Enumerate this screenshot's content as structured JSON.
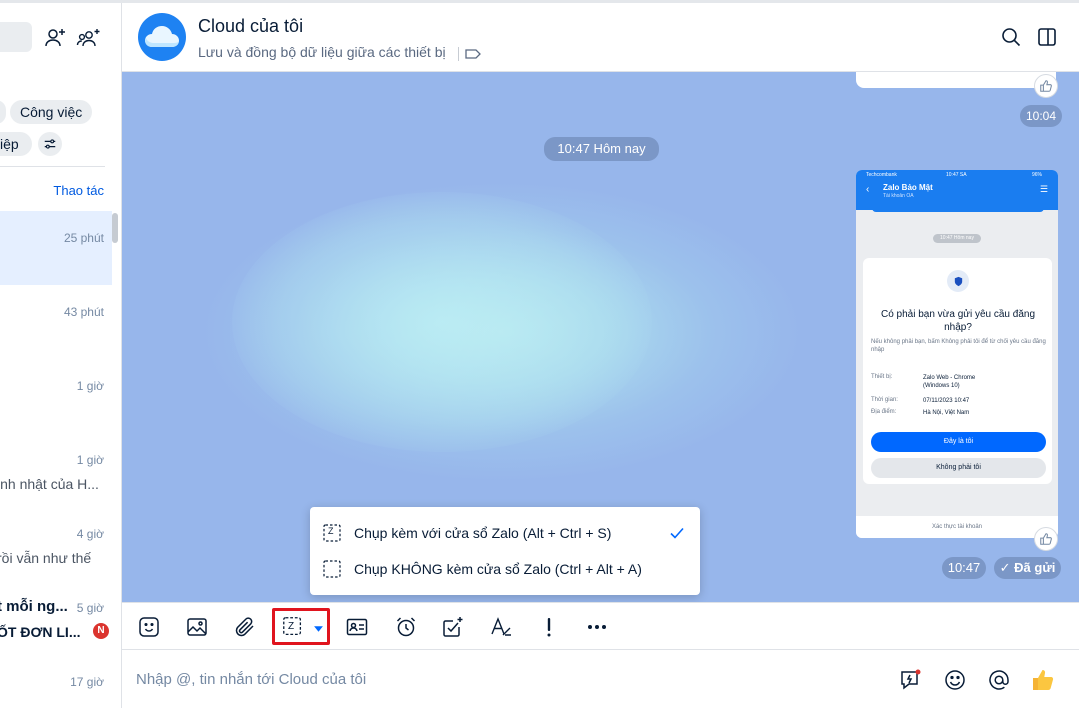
{
  "sidebar": {
    "chips": [
      "Công việc",
      "iệp"
    ],
    "action_label": "Thao tác",
    "conversations": [
      {
        "time": "25 phút",
        "name": "",
        "preview": "",
        "badge": ""
      },
      {
        "time": "43 phút",
        "name": "",
        "preview": "",
        "badge": ""
      },
      {
        "time": "1 giờ",
        "name": "",
        "preview": "",
        "badge": ""
      },
      {
        "time": "1 giờ",
        "name": "",
        "preview": "inh nhật của H...",
        "badge": ""
      },
      {
        "time": "4 giờ",
        "name": "",
        "preview": "rồi vẫn như thế",
        "badge": ""
      },
      {
        "time": "5 giờ",
        "name": "t mỗi ng...",
        "preview": "ỐT ĐƠN LI...",
        "badge": "N"
      },
      {
        "time": "17 giờ",
        "name": "",
        "preview": "",
        "badge": ""
      }
    ]
  },
  "header": {
    "title": "Cloud của tôi",
    "subtitle": "Lưu và đồng bộ dữ liệu giữa các thiết bị"
  },
  "chat": {
    "prev_time": "10:04",
    "day_separator": "10:47 Hôm nay",
    "image_time": "10:47",
    "sent_status": "Đã gửi",
    "phone": {
      "carrier": "Techcombank",
      "clock": "10:47 SA",
      "battery": "96%",
      "name": "Zalo Bảo Mật",
      "sub": "Tài khoản OA",
      "pill": "10:47 Hôm nay",
      "question": "Có phải bạn vừa gửi yêu cầu đăng nhập?",
      "note": "Nếu không phải bạn, bấm Không phải tôi để từ chối yêu cầu đăng nhập",
      "device_label": "Thiết bị:",
      "device_value": "Zalo Web - Chrome (Windows 10)",
      "time_label": "Thời gian:",
      "time_value": "07/11/2023 10:47",
      "place_label": "Địa điểm:",
      "place_value": "Hà Nội, Việt Nam",
      "confirm": "Đây là tôi",
      "deny": "Không phải tôi",
      "footer": "Xác thực tài khoản"
    }
  },
  "capture_menu": {
    "items": [
      {
        "label": "Chụp kèm với cửa sổ Zalo (Alt + Ctrl + S)",
        "checked": true
      },
      {
        "label": "Chụp KHÔNG kèm cửa sổ Zalo (Ctrl + Alt + A)",
        "checked": false
      }
    ]
  },
  "toolbar": {
    "icons": [
      "sticker-icon",
      "image-icon",
      "attachment-icon",
      "screenshot-icon",
      "contact-card-icon",
      "reminder-icon",
      "task-icon",
      "text-format-icon",
      "urgent-icon",
      "more-icon"
    ]
  },
  "input": {
    "placeholder": "Nhập @, tin nhắn tới Cloud của tôi"
  },
  "colors": {
    "accent": "#0068ff",
    "highlight_box": "#e0141e",
    "badge": "#db342e"
  }
}
